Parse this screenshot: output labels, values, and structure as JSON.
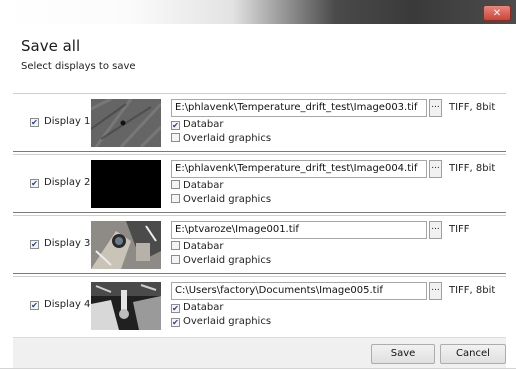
{
  "window": {
    "close_glyph": "✕"
  },
  "dialog": {
    "title": "Save all",
    "subtitle": "Select displays to save"
  },
  "rows": [
    {
      "label": "Display 1",
      "checked": true,
      "path": "E:\\phlavenk\\Temperature_drift_test\\Image003.tif",
      "browse": "...",
      "format": "TIFF, 8bit",
      "databar": true,
      "overlaid": false,
      "databar_label": "Databar",
      "overlaid_label": "Overlaid graphics",
      "thumb": "gray-textured-sample"
    },
    {
      "label": "Display 2",
      "checked": true,
      "path": "E:\\phlavenk\\Temperature_drift_test\\Image004.tif",
      "browse": "...",
      "format": "TIFF, 8bit",
      "databar": false,
      "overlaid": false,
      "databar_label": "Databar",
      "overlaid_label": "Overlaid graphics",
      "thumb": "black"
    },
    {
      "label": "Display 3",
      "checked": true,
      "path": "E:\\ptvaroze\\Image001.tif",
      "browse": "...",
      "format": "TIFF",
      "databar": false,
      "overlaid": false,
      "databar_label": "Databar",
      "overlaid_label": "Overlaid graphics",
      "thumb": "chamber-photo"
    },
    {
      "label": "Display 4",
      "checked": true,
      "path": "C:\\Users\\factory\\Documents\\Image005.tif",
      "browse": "...",
      "format": "TIFF, 8bit",
      "databar": true,
      "overlaid": true,
      "databar_label": "Databar",
      "overlaid_label": "Overlaid graphics",
      "thumb": "grayscale-chamber"
    }
  ],
  "footer": {
    "save_label": "Save",
    "cancel_label": "Cancel"
  },
  "colors": {
    "check": "#213f8f",
    "close": "#c9463a"
  }
}
